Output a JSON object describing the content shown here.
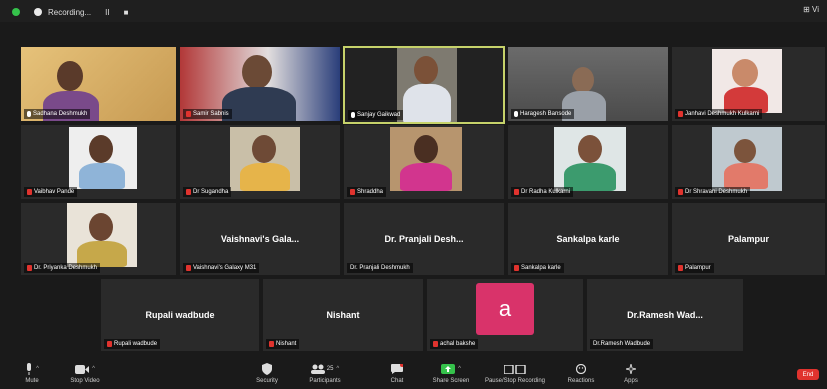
{
  "top_bar": {
    "recording_label": "Recording...",
    "pause_label": "II",
    "stop_label": "■",
    "view_label": "⊞ Vi"
  },
  "participants_row1": [
    {
      "name": "Sadhana Deshmukh",
      "muted": false
    },
    {
      "name": "Samir Sabnis",
      "muted": true
    },
    {
      "name": "Sanjay Gaikwad",
      "muted": false,
      "active_speaker": true
    },
    {
      "name": "Haragesh Bansode",
      "muted": false
    },
    {
      "name": "Janhavi Deshmukh Kulkarni",
      "muted": true
    }
  ],
  "participants_row2": [
    {
      "name": "Vaibhav Pande",
      "muted": true
    },
    {
      "name": "Dr Sugandha",
      "muted": true
    },
    {
      "name": "Shraddha",
      "muted": true
    },
    {
      "name": "Dr Radha Kulkarni",
      "muted": true
    },
    {
      "name": "Dr Shravani Deshmukh",
      "muted": true
    }
  ],
  "participants_row3": [
    {
      "name": "Dr. Priyanka Deshmukh",
      "muted": true,
      "has_video": true
    },
    {
      "name": "Vaishnavi's Galaxy M31",
      "display": "Vaishnavi's Gala...",
      "muted": true,
      "has_video": false
    },
    {
      "name": "Dr. Pranjali Deshmukh",
      "display": "Dr. Pranjali Desh...",
      "muted": false,
      "has_video": false
    },
    {
      "name": "Sankalpa karle",
      "display": "Sankalpa karle",
      "muted": true,
      "has_video": false
    },
    {
      "name": "Palampur",
      "display": "Palampur",
      "muted": true,
      "has_video": false
    }
  ],
  "participants_row4": [
    {
      "name": "Rupali wadbude",
      "display": "Rupali wadbude",
      "muted": true
    },
    {
      "name": "Nishant",
      "display": "Nishant",
      "muted": true
    },
    {
      "name": "achal bakshe",
      "avatar_letter": "a",
      "muted": true
    },
    {
      "name": "Dr.Ramesh Wadbude",
      "display": "Dr.Ramesh Wad...",
      "muted": false
    }
  ],
  "toolbar": {
    "unmute": "Mute",
    "stop_video": "Stop Video",
    "security": "Security",
    "participants": "Participants",
    "participants_count": "25",
    "chat": "Chat",
    "share_screen": "Share Screen",
    "pause_recording": "Pause/Stop Recording",
    "reactions": "Reactions",
    "apps": "Apps",
    "end": "End"
  },
  "colors": {
    "background": "#1a1a1a",
    "tile": "#2a2a2a",
    "active_border": "#c6d26a",
    "muted_red": "#e0332e",
    "avatar_pink": "#d9336a",
    "share_green": "#35c24b"
  }
}
